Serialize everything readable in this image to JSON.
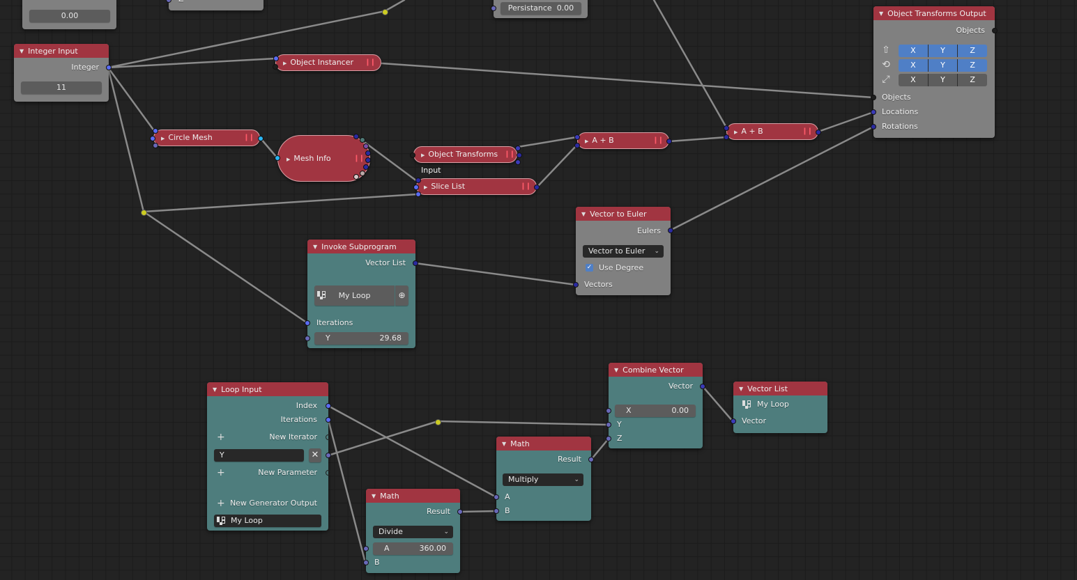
{
  "partial_nodes": {
    "top_left_value": "0.00",
    "top_mid_socket_label": "Z",
    "persistance": {
      "label": "Persistance",
      "value": "0.00"
    }
  },
  "integer_input": {
    "title": "Integer Input",
    "output": "Integer",
    "value": "11"
  },
  "object_instancer": {
    "title": "Object Instancer"
  },
  "circle_mesh": {
    "title": "Circle Mesh"
  },
  "mesh_info": {
    "title": "Mesh Info"
  },
  "object_transforms_input": {
    "title": "Object Transforms Input"
  },
  "slice_list": {
    "title": "Slice List"
  },
  "a_plus_b_1": {
    "title": "A + B"
  },
  "a_plus_b_2": {
    "title": "A + B"
  },
  "object_transforms_output": {
    "title": "Object Transforms Output",
    "output": "Objects",
    "rows": [
      {
        "icon": "location-icon",
        "axes": [
          "X",
          "Y",
          "Z"
        ],
        "enabled": true
      },
      {
        "icon": "rotation-icon",
        "axes": [
          "X",
          "Y",
          "Z"
        ],
        "enabled": true
      },
      {
        "icon": "scale-icon",
        "axes": [
          "X",
          "Y",
          "Z"
        ],
        "enabled": false
      }
    ],
    "inputs": [
      "Objects",
      "Locations",
      "Rotations"
    ]
  },
  "vector_to_euler": {
    "title": "Vector to Euler",
    "output": "Eulers",
    "mode": "Vector to Euler",
    "use_degree_label": "Use Degree",
    "use_degree": true,
    "input": "Vectors"
  },
  "invoke_subprogram": {
    "title": "Invoke Subprogram",
    "output": "Vector List",
    "subprogram": "My Loop",
    "inputs": [
      "Iterations"
    ],
    "y_field": {
      "label": "Y",
      "value": "29.68"
    }
  },
  "loop_input": {
    "title": "Loop Input",
    "outputs": [
      "Index",
      "Iterations"
    ],
    "new_iterator": "New Iterator",
    "iterator_name": "Y",
    "new_parameter": "New Parameter",
    "new_generator_output": "New Generator Output",
    "loop_name": "My Loop"
  },
  "math_divide": {
    "title": "Math",
    "output": "Result",
    "operation": "Divide",
    "a_field": {
      "label": "A",
      "value": "360.00"
    },
    "input_b": "B"
  },
  "math_multiply": {
    "title": "Math",
    "output": "Result",
    "operation": "Multiply",
    "inputs": [
      "A",
      "B"
    ]
  },
  "combine_vector": {
    "title": "Combine Vector",
    "output": "Vector",
    "x_field": {
      "label": "X",
      "value": "0.00"
    },
    "inputs": [
      "Y",
      "Z"
    ]
  },
  "vector_list": {
    "title": "Vector List",
    "loop_name": "My Loop",
    "input": "Vector"
  },
  "colors": {
    "header_red": "#a13541",
    "node_gray": "#808080",
    "node_teal": "#4e7d7d",
    "background": "#232323",
    "axis_enabled": "#4f7fc6",
    "reroute_yellow": "#cccc22"
  }
}
